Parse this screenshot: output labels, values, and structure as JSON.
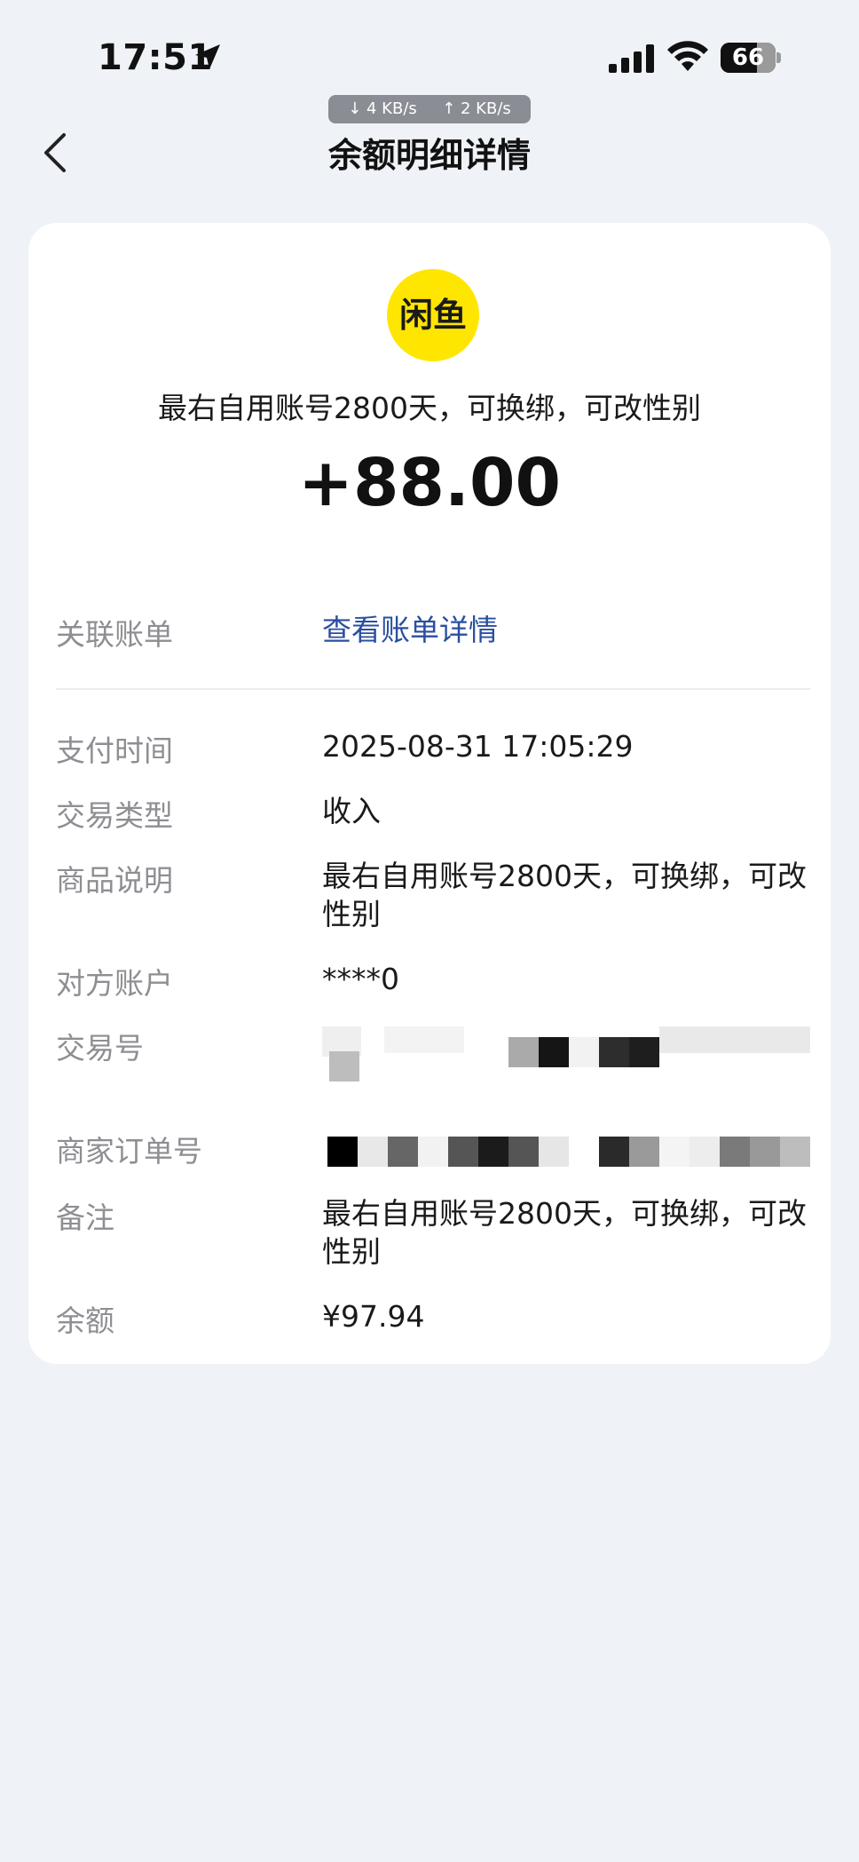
{
  "status_bar": {
    "time": "17:51",
    "battery": "66",
    "battery_level": 0.66
  },
  "network_speed": {
    "down": "↓ 4 KB/s",
    "up": "↑ 2 KB/s"
  },
  "nav": {
    "title": "余额明细详情"
  },
  "merchant": {
    "logo_text": "闲鱼",
    "logo_color": "#ffe600"
  },
  "summary": {
    "description": "最右自用账号2800天，可换绑，可改性别",
    "amount": "+88.00"
  },
  "details": {
    "linked_bill": {
      "label": "关联账单",
      "value": "查看账单详情"
    },
    "pay_time": {
      "label": "支付时间",
      "value": "2025-08-31 17:05:29"
    },
    "trade_type": {
      "label": "交易类型",
      "value": "收入"
    },
    "product_desc": {
      "label": "商品说明",
      "value": "最右自用账号2800天，可换绑，可改性别"
    },
    "counterparty": {
      "label": "对方账户",
      "value": "****0"
    },
    "trade_no": {
      "label": "交易号"
    },
    "merchant_order_no": {
      "label": "商家订单号"
    },
    "remark": {
      "label": "备注",
      "value": "最右自用账号2800天，可换绑，可改性别"
    },
    "balance": {
      "label": "余额",
      "value": "¥97.94"
    }
  },
  "colors": {
    "link": "#2a4fa0",
    "background": "#eff2f7"
  }
}
